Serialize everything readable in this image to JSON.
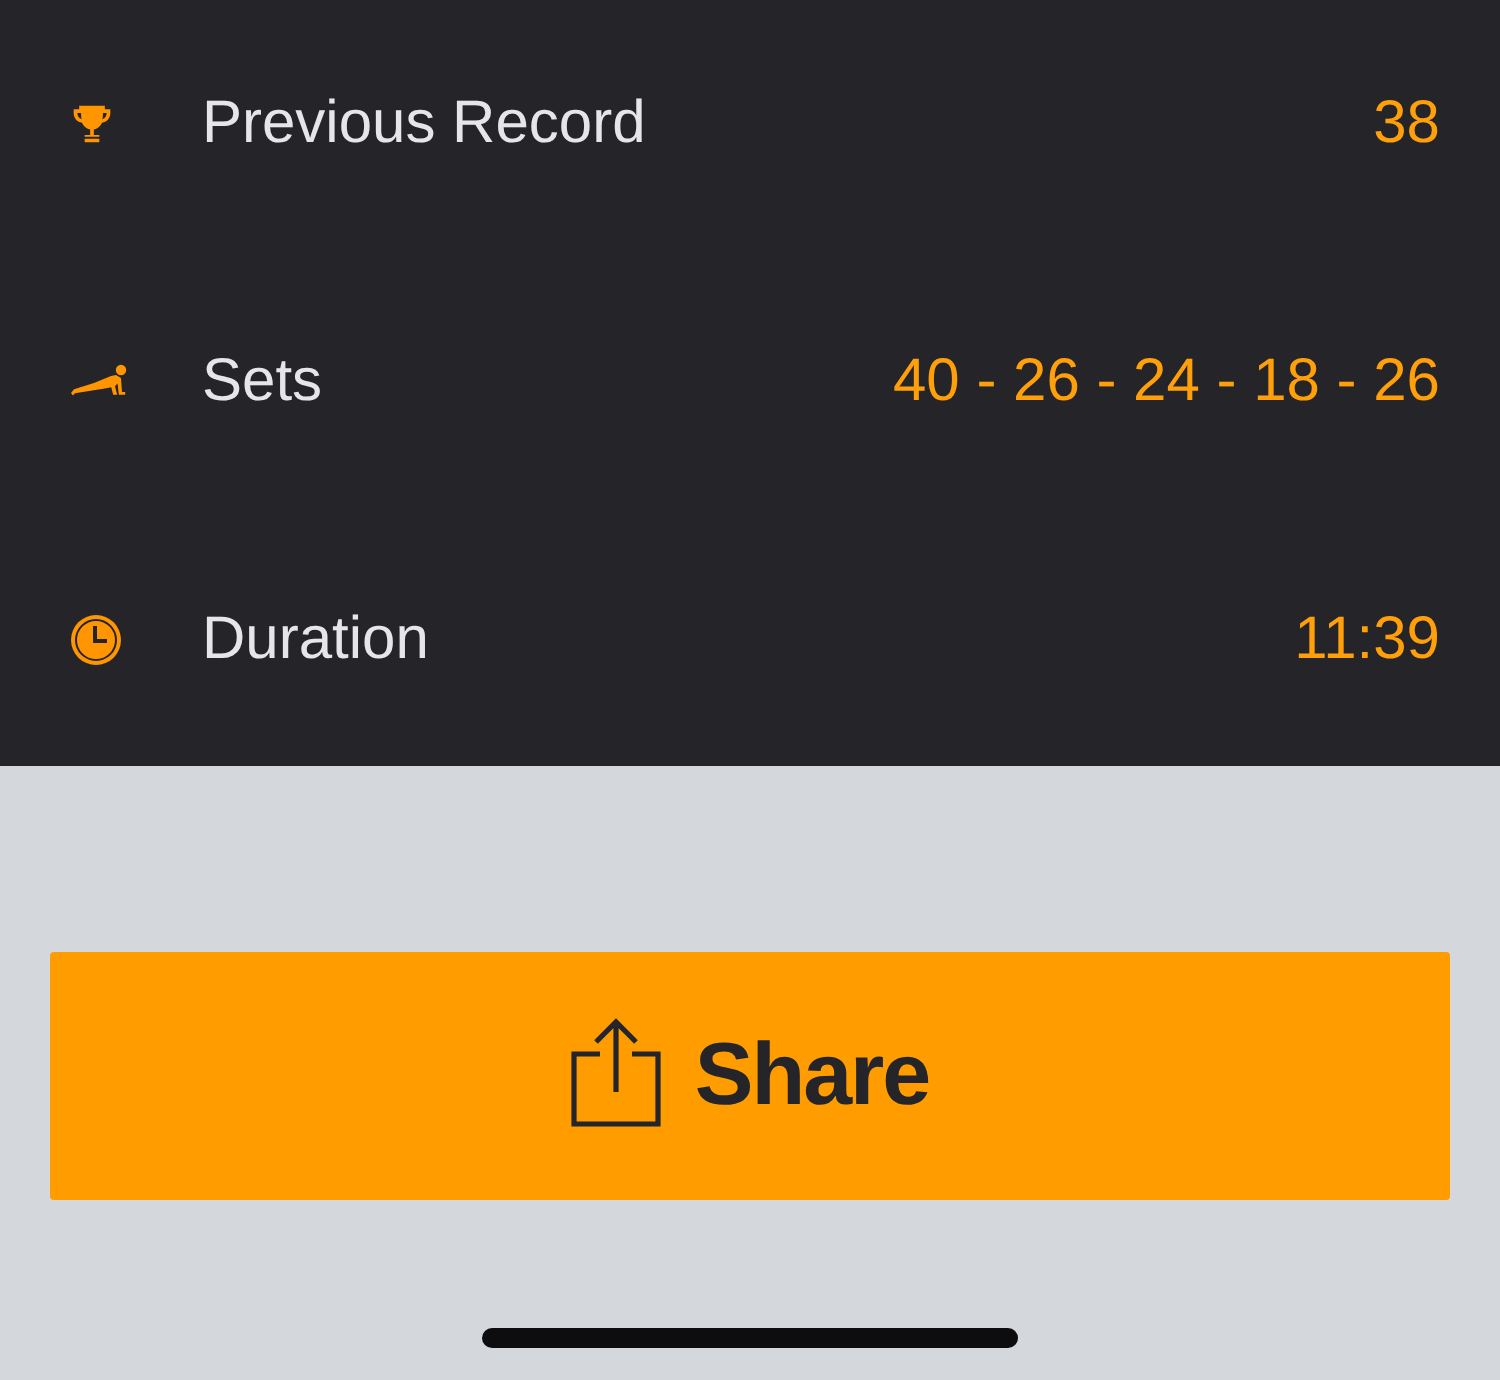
{
  "stats": [
    {
      "kind": "record",
      "label": "Previous Record",
      "value": "38"
    },
    {
      "kind": "sets",
      "label": "Sets",
      "value": "40 - 26 - 24 - 18 - 26"
    },
    {
      "kind": "duration",
      "label": "Duration",
      "value": "11:39"
    }
  ],
  "share_button": {
    "label": "Share"
  }
}
